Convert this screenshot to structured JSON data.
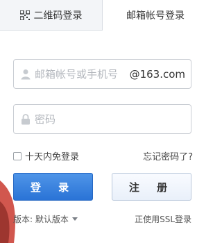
{
  "tabs": {
    "qr_label": "二维码登录",
    "mail_label": "邮箱帐号登录"
  },
  "email": {
    "placeholder": "邮箱帐号或手机号",
    "domain": "@163.com"
  },
  "password": {
    "placeholder": "密码"
  },
  "remember_label": "十天内免登录",
  "forgot_label": "忘记密码了?",
  "login_label": "登 录",
  "register_label": "注 册",
  "version_label": "版本: 默认版本",
  "ssl_label": "正使用SSL登录",
  "icons": {
    "qr": "qr-code-icon",
    "user": "user-icon",
    "lock": "lock-icon",
    "caret": "chevron-down-icon"
  },
  "colors": {
    "primary": "#2a73d6",
    "border": "#c9cdd3",
    "tab_inactive_bg": "#f3f5f8"
  }
}
